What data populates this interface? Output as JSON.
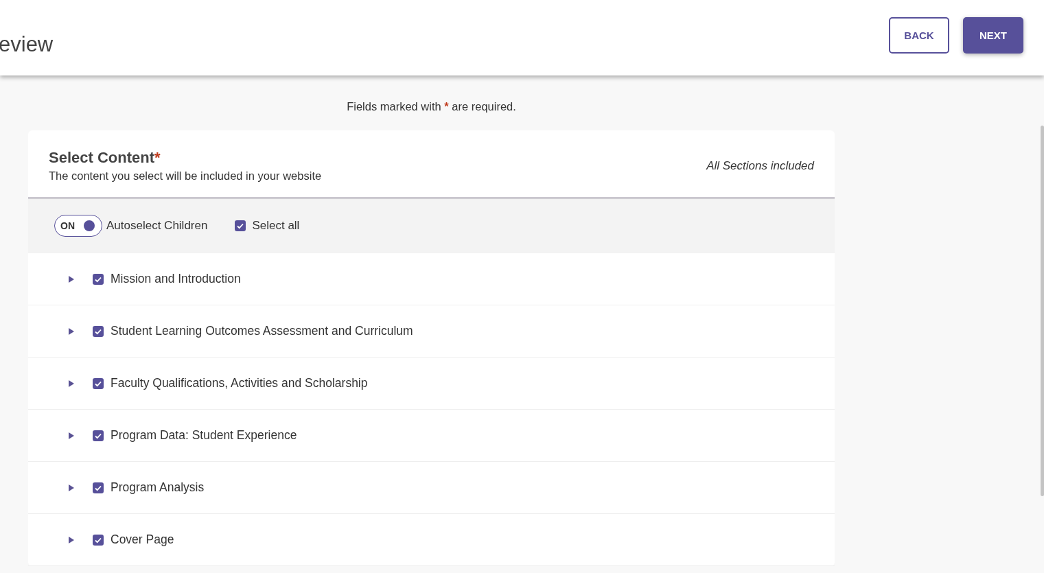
{
  "header": {
    "title": "eview",
    "buttons": [
      {
        "label": "BACK",
        "kind": "outline"
      },
      {
        "label": "NEXT",
        "kind": "filled"
      }
    ]
  },
  "notice": {
    "before": "Fields marked with",
    "mark": "*",
    "after": "are required."
  },
  "card": {
    "title": "Select Content",
    "required_mark": "*",
    "subtitle": "The content you select will be included in your website",
    "status": "All Sections included",
    "autoselect": {
      "switch_label": "ON",
      "on": true,
      "label": "Autoselect Children"
    },
    "select_all": {
      "label": "Select all",
      "checked": true
    },
    "sections": [
      {
        "label": "Mission and Introduction",
        "checked": true,
        "expanded": false
      },
      {
        "label": "Student Learning Outcomes Assessment and Curriculum",
        "checked": true,
        "expanded": false
      },
      {
        "label": "Faculty Qualifications, Activities and Scholarship",
        "checked": true,
        "expanded": false
      },
      {
        "label": "Program Data: Student Experience",
        "checked": true,
        "expanded": false
      },
      {
        "label": "Program Analysis",
        "checked": true,
        "expanded": false
      },
      {
        "label": "Cover Page",
        "checked": true,
        "expanded": false
      }
    ]
  }
}
